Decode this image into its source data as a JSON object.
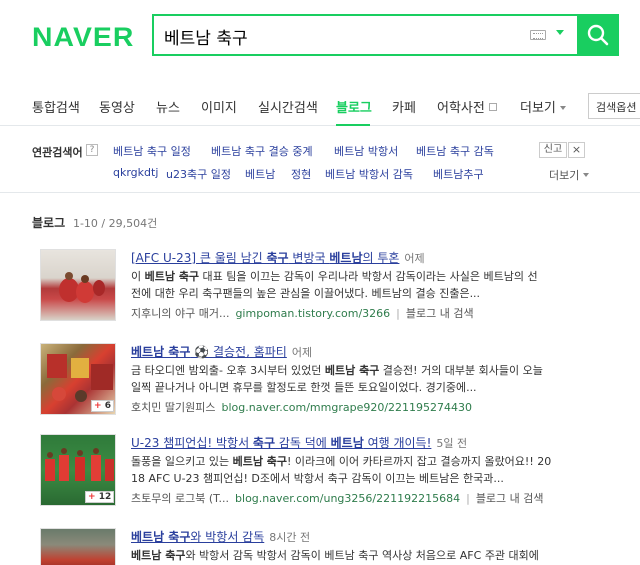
{
  "header": {
    "logo": "NAVER",
    "search_value": "베트남 축구",
    "search_button": "search"
  },
  "nav": {
    "tabs": [
      "통합검색",
      "동영상",
      "뉴스",
      "이미지",
      "실시간검색",
      "블로그",
      "카페",
      "어학사전",
      "더보기"
    ],
    "active": "블로그",
    "search_option": "검색옵션"
  },
  "related": {
    "title": "연관검색어",
    "help": "?",
    "row1": [
      "베트남 축구 일정",
      "베트남 축구 결승 중계",
      "베트남 박항서",
      "베트남 축구 감독"
    ],
    "row2": [
      "qkrgkdtj",
      "u23축구 일정",
      "베트남",
      "정현",
      "베트남 박항서 감독",
      "베트남추구"
    ],
    "report": "신고",
    "close": "×",
    "more": "더보기"
  },
  "section": {
    "title": "블로그",
    "count": "1-10 / 29,504건"
  },
  "results": [
    {
      "title_parts": [
        "[AFC U-23] 큰 울림 남긴 ",
        "축구",
        " 변방국 ",
        "베트남",
        "의 투혼"
      ],
      "time": "어제",
      "desc_line1": [
        "이 ",
        "베트남 축구",
        " 대표 팀을 이끄는 감독이 우리나라 박항서 감독이라는 사실은 베트남의 선"
      ],
      "desc_line2": "전에 대한 우리 축구팬들의 높은 관심을 이끌어냈다. 베트남의 결승 진출은...",
      "author": "지후니의 야구 매거...",
      "url": "gimpoman.tistory.com/3266",
      "in_search": "블로그 내 검색",
      "badge": ""
    },
    {
      "title_parts": [
        "베트남 축구",
        " ⚽ 결승전, 홈파티"
      ],
      "time": "어제",
      "desc_line1": [
        "금 타오디엔 밤외출- 오후 3시부터 있었던 ",
        "베트남 축구",
        " 결승전! 거의 대부분 회사들이 오늘"
      ],
      "desc_line2": "일찍 끝나거나 아니면 휴무를 할정도로 한껏 들뜬 토요일이었다. 경기중에...",
      "author": "호치민 딸기원피스",
      "url": "blog.naver.com/mmgrape920/221195274430",
      "in_search": "",
      "badge": "6"
    },
    {
      "title_parts": [
        "U-23 챔피언십! 박항서 ",
        "축구",
        " 감독 덕에 ",
        "베트남",
        " 여행 개이득!"
      ],
      "time": "5일 전",
      "desc_line1": [
        "돌풍을 일으키고 있는 ",
        "베트남 축구",
        "! 이라크에 이어 카타르까지 잡고 결승까지 올랐어요!! 20"
      ],
      "desc_line2": "18 AFC U-23 챔피언십! D조에서 박항서 축구 감독이 이끄는 베트남은 한국과...",
      "author": "츠토무의 로그북 (T...",
      "url": "blog.naver.com/ung3256/221192215684",
      "in_search": "블로그 내 검색",
      "badge": "12"
    },
    {
      "title_parts": [
        "베트남 축구",
        "와 박항서 감독"
      ],
      "time": "8시간 전",
      "desc_line1": [
        "",
        "베트남 축구",
        "와 박항서 감독 박항서 감독이 베트남 축구 역사상 처음으로 AFC 주관 대회에"
      ],
      "desc_line2": "",
      "author": "",
      "url": "",
      "in_search": "",
      "badge": ""
    }
  ]
}
